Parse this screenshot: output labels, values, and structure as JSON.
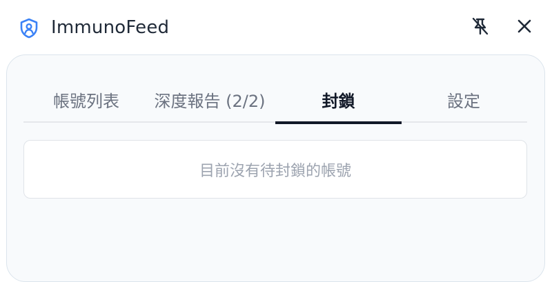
{
  "app": {
    "title": "ImmunoFeed",
    "icon": "shield-user-icon",
    "accent_color": "#3b82f6"
  },
  "window_controls": {
    "pin_icon": "unpin-icon",
    "close_icon": "close-icon"
  },
  "tabs": [
    {
      "label": "帳號列表",
      "active": false
    },
    {
      "label": "深度報告 (2/2)",
      "active": false
    },
    {
      "label": "封鎖",
      "active": true
    },
    {
      "label": "設定",
      "active": false
    }
  ],
  "block_panel": {
    "empty_message": "目前沒有待封鎖的帳號"
  }
}
